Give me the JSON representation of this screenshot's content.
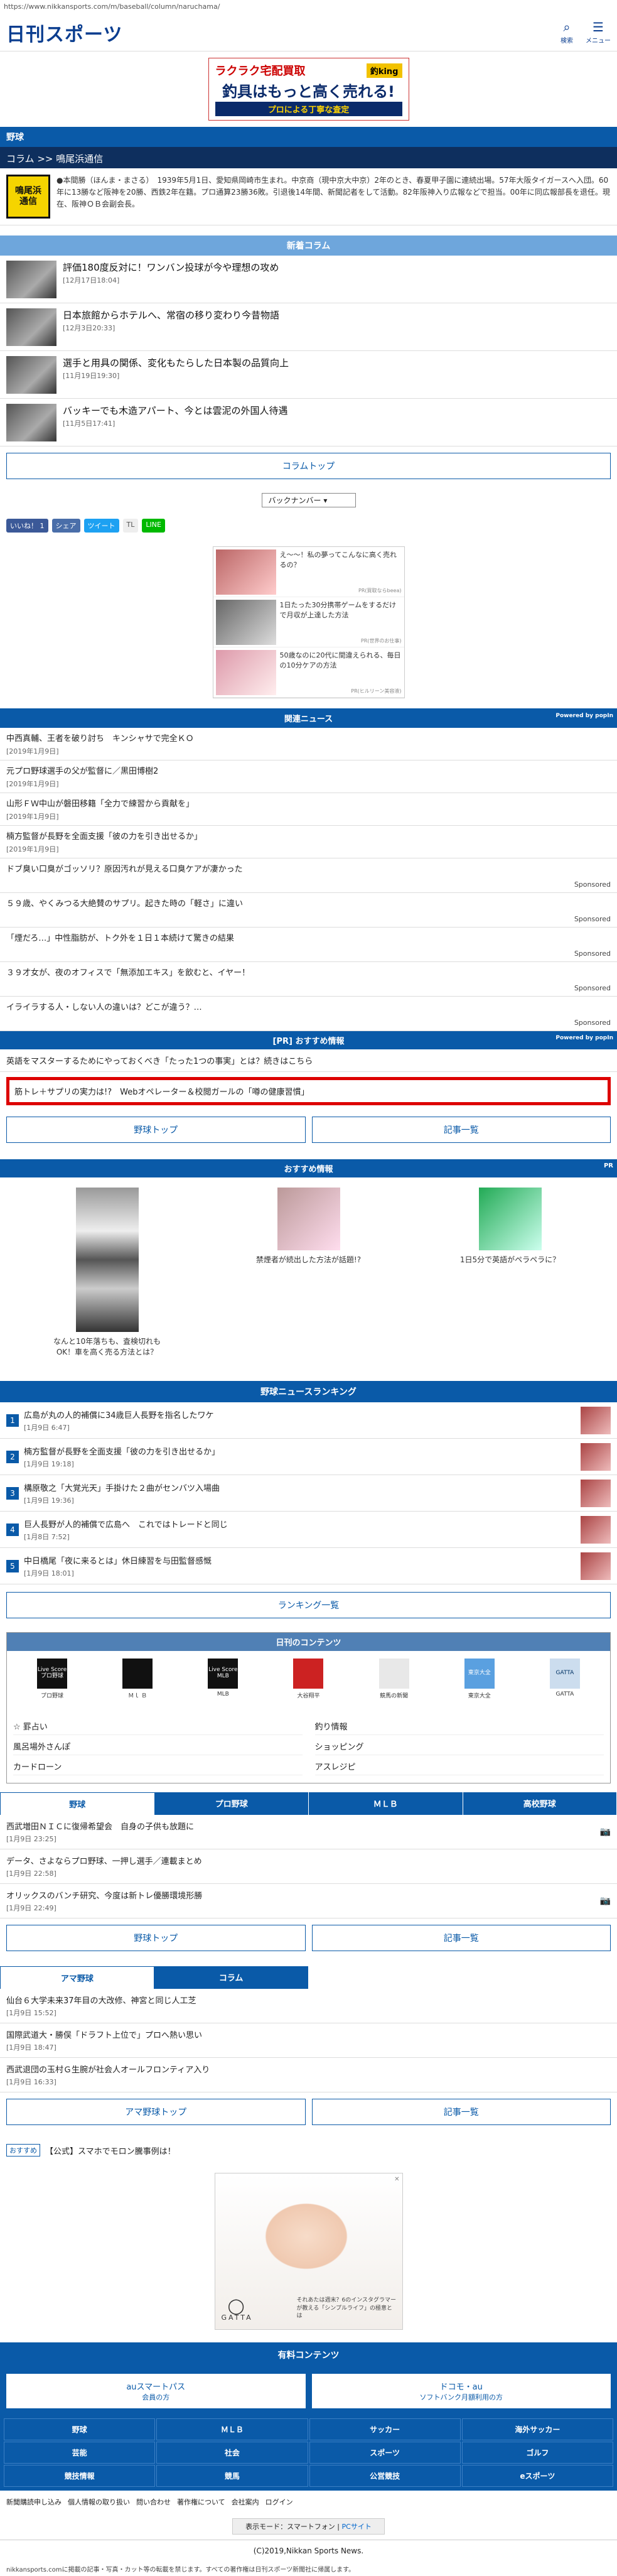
{
  "url": "https://www.nikkansports.com/m/baseball/column/naruchama/",
  "header": {
    "logo": "日刊スポーツ",
    "search_label": "検索",
    "menu_label": "メニュー"
  },
  "top_ad": {
    "line1": "ラクラク宅配買取",
    "brand": "釣king",
    "headline": "釣具はもっと高く売れる!",
    "footer": "プロによる丁寧な査定"
  },
  "section_title": "野球",
  "breadcrumb": "コラム >> 鳴尾浜通信",
  "column": {
    "logo_line1": "鳴尾浜",
    "logo_line2": "通信",
    "description": "●本間勝（ほんま・まさる）　1939年5月1日、愛知県岡崎市生まれ。中京商（現中京大中京）2年のとき、春夏甲子園に連続出場。57年大阪タイガースへ入団。60年に13勝など阪神を20勝、西鉄2年在籍。プロ通算23勝36敗。引退後14年間、新聞記者をして活動。82年阪神入り広報などで担当。00年に同広報部長を退任。現在、阪神ＯＢ会副会長。"
  },
  "latest_header": "新着コラム",
  "latest": [
    {
      "title": "評価180度反対に！ワンバン投球が今や理想の攻め",
      "date": "[12月17日18:04]"
    },
    {
      "title": "日本旅館からホテルへ、常宿の移り変わり今昔物語",
      "date": "[12月3日20:33]"
    },
    {
      "title": "選手と用具の関係、変化もたらした日本製の品質向上",
      "date": "[11月19日19:30]"
    },
    {
      "title": "バッキーでも木造アパート、今とは雲泥の外国人待遇",
      "date": "[11月5日17:41]"
    }
  ],
  "column_top_button": "コラムトップ",
  "backnumber_select": "バックナンバー",
  "social": {
    "like": "いいね！ 1",
    "share": "シェア",
    "tweet": "ツイート",
    "tl": "TL",
    "line": "LINE"
  },
  "reco": [
    {
      "text": "え〜〜！私の夢ってこんなに高く売れるの？",
      "src": "PR(買取ならbeea)"
    },
    {
      "text": "1日たった30分携帯ゲームをするだけで月収が上達した方法",
      "src": "PR(世界のお仕事)"
    },
    {
      "text": "50歳なのに20代に間違えられる、毎日の10分ケアの方法",
      "src": "PR(ヒルリーン美容液)"
    }
  ],
  "related_news_header": "関連ニュース",
  "powered_by": "Powered by popIn",
  "related_news": [
    {
      "title": "中西真輔、王者を破り討ち　キンシャサで完全ＫＯ",
      "date": "[2019年1月9日]",
      "sponsored": ""
    },
    {
      "title": "元プロ野球選手の父が監督に／黒田博樹2",
      "date": "[2019年1月9日]",
      "sponsored": ""
    },
    {
      "title": "山形ＦＷ中山が磐田移籍「全力で練習から貢献を」",
      "date": "[2019年1月9日]",
      "sponsored": ""
    },
    {
      "title": "楠方監督が長野を全面支援「彼の力を引き出せるか」",
      "date": "[2019年1月9日]",
      "sponsored": ""
    },
    {
      "title": "ドブ臭い口臭がゴッソリ？原因汚れが見える口臭ケアが凄かった",
      "date": "",
      "sponsored": "Sponsored"
    },
    {
      "title": "５９歳、やくみつる大絶賛のサプリ。起きた時の「軽さ」に違い",
      "date": "",
      "sponsored": "Sponsored"
    },
    {
      "title": "「煙だろ…」中性脂肪が、トク外を１日１本続けて驚きの結果",
      "date": "",
      "sponsored": "Sponsored"
    },
    {
      "title": "３９才女が、夜のオフィスで「無添加エキス」を飲むと、イヤー！",
      "date": "",
      "sponsored": "Sponsored"
    },
    {
      "title": "イライラする人・しない人の違いは？どこが違う？…",
      "date": "",
      "sponsored": "Sponsored"
    }
  ],
  "pr_header": "[PR] おすすめ情報",
  "pr_items": [
    "英語をマスターするためにやっておくべき「たった1つの事実」とは？続きはこちら"
  ],
  "pr_highlight": "筋トレ＋サプリの実力は!?　Webオペレーター＆校閲ガールの「噂の健康習慣」",
  "buttons_row1": [
    "野球トップ",
    "記事一覧"
  ],
  "osusume_header": "おすすめ情報",
  "osusume_pr": "PR",
  "osusume": [
    "なんと10年落ちも、査検切れもOK！車を高く売る方法とは？",
    "禁煙者が続出した方法が話題!?",
    "1日5分で英語がペラペラに？"
  ],
  "ranking_header": "野球ニュースランキング",
  "ranking": [
    {
      "num": "1",
      "title": "広島が丸の人的補償に34歳巨人長野を指名したワケ",
      "date": "[1月9日 6:47]"
    },
    {
      "num": "2",
      "title": "楠方監督が長野を全面支援「彼の力を引き出せるか」",
      "date": "[1月9日 19:18]"
    },
    {
      "num": "3",
      "title": "構原敬之「大覚光天」手掛けた２曲がセンバツ入場曲",
      "date": "[1月9日 19:36]"
    },
    {
      "num": "4",
      "title": "巨人長野が人的補償で広島へ　これではトレードと同じ",
      "date": "[1月8日 7:52]"
    },
    {
      "num": "5",
      "title": "中日橋尾「夜に来るとは」休日練習を与田監督感慨",
      "date": "[1月9日 18:01]"
    }
  ],
  "ranking_button": "ランキング一覧",
  "content_head": "日刊のコンテンツ",
  "content_icons": [
    {
      "box": "Live Score プロ野球",
      "label": "プロ野球"
    },
    {
      "box": "",
      "label": "Ｍｌ Ｂ"
    },
    {
      "box": "Live Score MLB",
      "label": "MLB"
    },
    {
      "box": "",
      "label": "大谷翔平"
    },
    {
      "box": "",
      "label": "競馬の新聞"
    },
    {
      "box": "東京大全",
      "label": "東京大全"
    },
    {
      "box": "GATTA",
      "label": "GATTA"
    }
  ],
  "content_links": [
    "☆ 罫占い",
    "釣り情報",
    "風呂場外さんぽ",
    "ショッピング",
    "カードローン",
    "アスレジピ"
  ],
  "tabs1": [
    "野球",
    "プロ野球",
    "ＭＬＢ",
    "高校野球"
  ],
  "tab1_list": [
    {
      "title": "西武増田ＮＩＣに復帰希望会　自身の子供も放題に",
      "date": "[1月9日 23:25]"
    },
    {
      "title": "データ、さよならプロ野球、一押し選手／連載まとめ",
      "date": "[1月9日 22:58]"
    },
    {
      "title": "オリックスのバンチ研究、今度は新トレ優勝環境形勝",
      "date": "[1月9日 22:49]"
    }
  ],
  "buttons_row2": [
    "野球トップ",
    "記事一覧"
  ],
  "tabs2": [
    "アマ野球",
    "コラム"
  ],
  "tab2_list": [
    {
      "title": "仙台６大学未来37年目の大改修、神宮と同じ人工芝",
      "date": "[1月9日 15:52]"
    },
    {
      "title": "国際武道大・勝俣「ドラフト上位で」プロへ熱い思い",
      "date": "[1月9日 18:47]"
    },
    {
      "title": "西武退団の玉村Ｇ生腕が社会人オールフロンティア入り",
      "date": "[1月9日 16:33]"
    }
  ],
  "buttons_row3": [
    "アマ野球トップ",
    "記事一覧"
  ],
  "mobile_tag": "おすすめ",
  "mobile_text": "【公式】スマホでモロン騰事例は！",
  "gatta": {
    "logo": "GATTA",
    "text": "それあたは週末？6のインスタグラマーが教える「シンプルライフ」の極意とは",
    "close": "✕"
  },
  "paid_head": "有料コンテンツ",
  "paid_buttons": [
    {
      "main": "auスマートパス",
      "sub": "会員の方"
    },
    {
      "main": "ドコモ・au",
      "sub": "ソフトバンク月額利用の方"
    }
  ],
  "nav_grid": [
    "野球",
    "ＭＬＢ",
    "サッカー",
    "海外サッカー",
    "芸能",
    "社会",
    "スポーツ",
    "ゴルフ",
    "競技情報",
    "競馬",
    "公営競技",
    "eスポーツ"
  ],
  "footer_links": [
    "新聞購読申し込み",
    "個人情報の取り扱い",
    "問い合わせ",
    "著作権について",
    "会社案内",
    "ログイン"
  ],
  "display_mode_label": "表示モード：スマートフォン",
  "display_mode_link": "PCサイト",
  "copyright": "(C)2019,Nikkan Sports News.",
  "notice": "nikkansports.comに掲載の記事・写真・カット等の転載を禁じます。すべての著作権は日刊スポーツ新聞社に帰属します。"
}
